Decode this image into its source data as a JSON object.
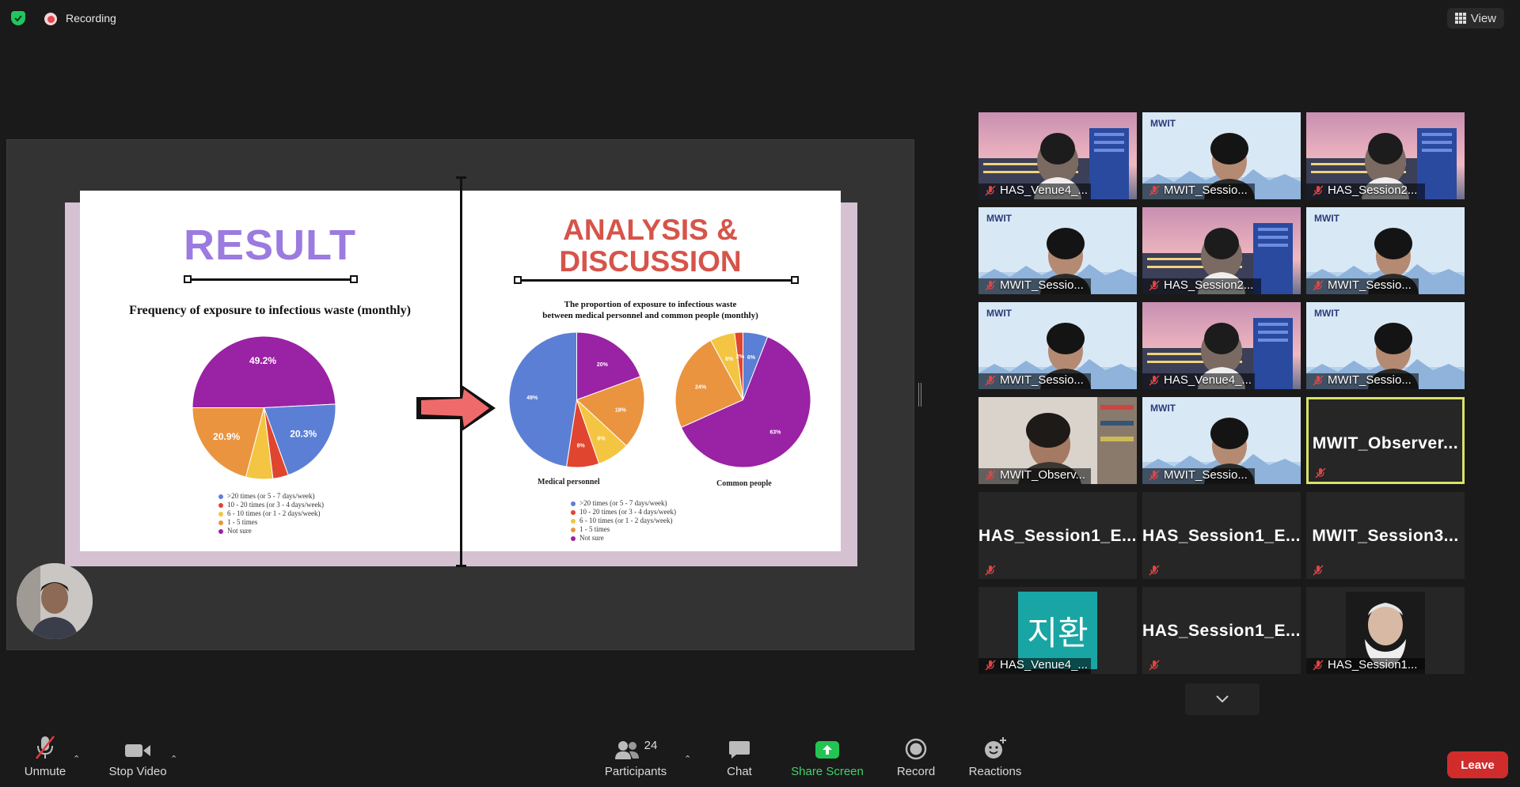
{
  "topbar": {
    "recording_label": "Recording",
    "view_label": "View"
  },
  "slide": {
    "left": {
      "title": "RESULT",
      "chart_title": "Frequency of exposure to infectious waste (monthly)",
      "legend": [
        ">20 times (or 5 - 7 days/week)",
        "10 - 20 times (or 3 - 4 days/week)",
        "6 - 10 times (or 1 - 2 days/week)",
        "1 - 5 times",
        "Not sure"
      ]
    },
    "right": {
      "title_line1": "ANALYSIS &",
      "title_line2": "DISCUSSION",
      "chart_title_line1": "The proportion of exposure to infectious waste",
      "chart_title_line2": "between medical personnel and common people (monthly)",
      "caption_medical": "Medical personnel",
      "caption_common": "Common people",
      "legend": [
        ">20 times (or 5 - 7 days/week)",
        "10 - 20 times (or 3 - 4 days/week)",
        "6 - 10 times (or 1 - 2 days/week)",
        "1 - 5 times",
        "Not sure"
      ]
    }
  },
  "colors": {
    "blue": "#5c7fd6",
    "red": "#e0452f",
    "yellow": "#f4c542",
    "orange": "#ea9440",
    "green": "#43a22f",
    "purple": "#9a22a5"
  },
  "chart_data": [
    {
      "type": "pie",
      "title": "Frequency of exposure to infectious waste (monthly)",
      "categories": [
        "Not sure",
        ">20 times (or 5 - 7 days/week)",
        "10 - 20 times (or 3 - 4 days/week)",
        "6 - 10 times (or 1 - 2 days/week)",
        "1 - 5 times"
      ],
      "values": [
        49.2,
        20.3,
        3.5,
        6.1,
        20.9
      ],
      "labels": [
        "49.2%",
        "20.3%",
        "",
        "",
        "20.9%"
      ]
    },
    {
      "type": "pie",
      "title": "Medical personnel",
      "categories": [
        "Not sure",
        "1 - 5 times",
        "6 - 10 times (or 1 - 2 days/week)",
        "10 - 20 times (or 3 - 4 days/week)",
        ">20 times (or 5 - 7 days/week)"
      ],
      "values": [
        20,
        18,
        8,
        8,
        49
      ],
      "labels": [
        "20%",
        "18%",
        "8%",
        "8%",
        "49%"
      ]
    },
    {
      "type": "pie",
      "title": "Common people",
      "categories": [
        ">20 times (or 5 - 7 days/week)",
        "Not sure",
        "1 - 5 times",
        "6 - 10 times (or 1 - 2 days/week)",
        "10 - 20 times (or 3 - 4 days/week)"
      ],
      "values": [
        6,
        63,
        24,
        6,
        2
      ],
      "labels": [
        "6%",
        "63%",
        "24%",
        "6%",
        "2%"
      ]
    }
  ],
  "gallery": [
    {
      "name": "HAS_Venue4_...",
      "bg": "campus"
    },
    {
      "name": "MWIT_Sessio...",
      "bg": "light"
    },
    {
      "name": "HAS_Session2...",
      "bg": "campus"
    },
    {
      "name": "MWIT_Sessio...",
      "bg": "light"
    },
    {
      "name": "HAS_Session2...",
      "bg": "campus"
    },
    {
      "name": "MWIT_Sessio...",
      "bg": "light"
    },
    {
      "name": "MWIT_Sessio...",
      "bg": "light"
    },
    {
      "name": "HAS_Venue4_...",
      "bg": "campus"
    },
    {
      "name": "MWIT_Sessio...",
      "bg": "light"
    },
    {
      "name": "MWIT_Observ...",
      "bg": "room"
    },
    {
      "name": "MWIT_Sessio...",
      "bg": "light"
    },
    {
      "bigname": "MWIT_Observer...",
      "bg": "dark",
      "active": true
    },
    {
      "bigname": "HAS_Session1_E...",
      "bg": "dark"
    },
    {
      "bigname": "HAS_Session1_E...",
      "bg": "dark"
    },
    {
      "bigname": "MWIT_Session3...",
      "bg": "dark"
    },
    {
      "name": "HAS_Venue4_...",
      "bg": "dark",
      "avatar_text": "지환"
    },
    {
      "bigname": "HAS_Session1_E...",
      "bg": "dark"
    },
    {
      "name": "HAS_Session1...",
      "bg": "dark",
      "avatar_img": true
    }
  ],
  "toolbar": {
    "unmute": "Unmute",
    "stop_video": "Stop Video",
    "participants": "Participants",
    "participants_count": "24",
    "chat": "Chat",
    "share_screen": "Share Screen",
    "record": "Record",
    "reactions": "Reactions",
    "leave": "Leave"
  }
}
